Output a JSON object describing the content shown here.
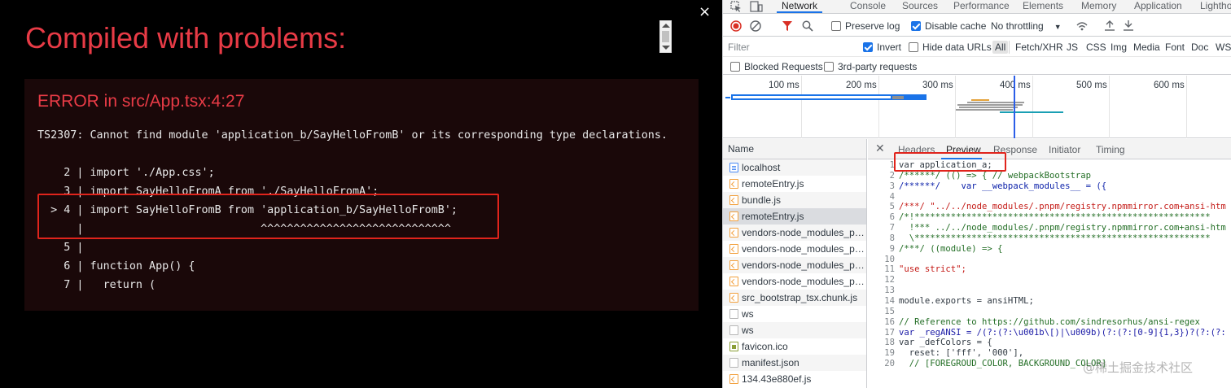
{
  "overlay": {
    "title": "Compiled with problems:",
    "close_label": "×",
    "error_heading": "ERROR in src/App.tsx:4:27",
    "error_message": "TS2307: Cannot find module 'application_b/SayHelloFromB' or its corresponding type declarations.",
    "code_lines": [
      "    2 | import './App.css';",
      "    3 | import SayHelloFromA from './SayHelloFromA';",
      "  > 4 | import SayHelloFromB from 'application_b/SayHelloFromB';",
      "      |                           ^^^^^^^^^^^^^^^^^^^^^^^^^^^^^",
      "    5 |",
      "    6 | function App() {",
      "    7 |   return ("
    ]
  },
  "devtools": {
    "tabs": [
      "Network",
      "Console",
      "Sources",
      "Performance",
      "Elements",
      "Memory",
      "Application",
      "Lighthouse"
    ],
    "active_tab": "Network",
    "toolbar": {
      "preserve_log": "Preserve log",
      "preserve_log_checked": false,
      "disable_cache": "Disable cache",
      "disable_cache_checked": true,
      "throttling": "No throttling"
    },
    "filter": {
      "placeholder": "Filter",
      "invert": "Invert",
      "invert_checked": true,
      "hide_data_urls": "Hide data URLs",
      "types": [
        "All",
        "Fetch/XHR",
        "JS",
        "CSS",
        "Img",
        "Media",
        "Font",
        "Doc",
        "WS"
      ]
    },
    "blocked_requests": "Blocked Requests",
    "third_party": "3rd-party requests",
    "timeline_ticks": [
      "100 ms",
      "200 ms",
      "300 ms",
      "400 ms",
      "500 ms",
      "600 ms"
    ],
    "names_header": "Name",
    "requests": [
      {
        "name": "localhost",
        "icon": "doc-icon"
      },
      {
        "name": "remoteEntry.js",
        "icon": "js-icon"
      },
      {
        "name": "bundle.js",
        "icon": "js-icon"
      },
      {
        "name": "remoteEntry.js",
        "icon": "js-icon",
        "selected": true
      },
      {
        "name": "vendors-node_modules_pn...",
        "icon": "js-icon"
      },
      {
        "name": "vendors-node_modules_pn...",
        "icon": "js-icon"
      },
      {
        "name": "vendors-node_modules_pn...",
        "icon": "js-icon"
      },
      {
        "name": "vendors-node_modules_pn...",
        "icon": "js-icon"
      },
      {
        "name": "src_bootstrap_tsx.chunk.js",
        "icon": "js-icon"
      },
      {
        "name": "ws",
        "icon": "blank-icon"
      },
      {
        "name": "ws",
        "icon": "blank-icon"
      },
      {
        "name": "favicon.ico",
        "icon": "blank-icon"
      },
      {
        "name": "manifest.json",
        "icon": "blank-icon"
      },
      {
        "name": "134.43e880ef.js",
        "icon": "js-icon"
      }
    ],
    "detail_tabs": [
      "Headers",
      "Preview",
      "Response",
      "Initiator",
      "Timing"
    ],
    "source_lines": [
      {
        "n": "1",
        "t": "var application_a;"
      },
      {
        "n": "2",
        "t": "/******/ (() => { // webpackBootstrap"
      },
      {
        "n": "3",
        "t": "/******/    var __webpack_modules__ = ({"
      },
      {
        "n": "4",
        "t": ""
      },
      {
        "n": "5",
        "t": "/***/ \"../../node_modules/.pnpm/registry.npmmirror.com+ansi-htm"
      },
      {
        "n": "6",
        "t": "/*!*********************************************************"
      },
      {
        "n": "7",
        "t": "  !*** ../../node_modules/.pnpm/registry.npmmirror.com+ansi-htm"
      },
      {
        "n": "8",
        "t": "  \\*********************************************************"
      },
      {
        "n": "9",
        "t": "/***/ ((module) => {"
      },
      {
        "n": "10",
        "t": ""
      },
      {
        "n": "11",
        "t": "\"use strict\";"
      },
      {
        "n": "12",
        "t": ""
      },
      {
        "n": "13",
        "t": ""
      },
      {
        "n": "14",
        "t": "module.exports = ansiHTML;"
      },
      {
        "n": "15",
        "t": ""
      },
      {
        "n": "16",
        "t": "// Reference to https://github.com/sindresorhus/ansi-regex"
      },
      {
        "n": "17",
        "t": "var _regANSI = /(?:(?:\\u001b\\[)|\\u009b)(?:(?:[0-9]{1,3})?(?:(?:"
      },
      {
        "n": "18",
        "t": "var _defColors = {"
      },
      {
        "n": "19",
        "t": "  reset: ['fff', '000'],"
      },
      {
        "n": "20",
        "t": "  // [FOREGROUD_COLOR, BACKGROUND_COLOR]"
      }
    ],
    "watermark": "@稀土掘金技术社区"
  },
  "colors": {
    "error_red": "#e83b46",
    "highlight_border": "#e0241c",
    "accent_blue": "#1a73e8"
  }
}
